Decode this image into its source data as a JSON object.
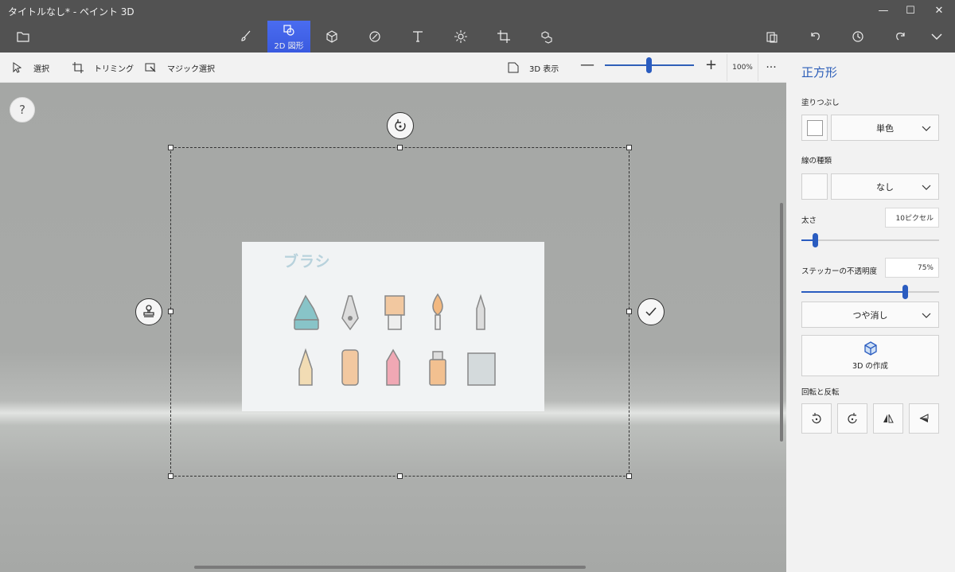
{
  "window": {
    "title": "タイトルなし* - ペイント 3D",
    "minimize": "—",
    "maximize": "☐",
    "close": "✕"
  },
  "toolbar": {
    "active_tool_label": "2D 図形",
    "tools": [
      "folder-icon",
      "brush-icon",
      "cube-icon",
      "sticker-icon",
      "text-icon",
      "effects-icon",
      "crop-icon",
      "mixed-reality-icon"
    ],
    "right_tools": [
      "paste-icon",
      "undo-icon",
      "history-icon",
      "redo-icon",
      "expand-icon"
    ]
  },
  "subbar": {
    "select": "選択",
    "crop": "トリミング",
    "magic_select": "マジック選択",
    "view3d": "3D 表示",
    "zoom_minus": "—",
    "zoom_plus": "+",
    "zoom_percent": "100%",
    "more": "···"
  },
  "canvas": {
    "help": "?",
    "sticker_title": "ブラシ"
  },
  "panel": {
    "title": "正方形",
    "fill_label": "塗りつぶし",
    "fill_value": "単色",
    "line_type_label": "線の種類",
    "line_type_value": "なし",
    "thickness_label": "太さ",
    "thickness_value": "10ピクセル",
    "thickness_level": 0.1,
    "opacity_label": "ステッカーの不透明度",
    "opacity_value": "75%",
    "opacity_level": 0.75,
    "finish_value": "つや消し",
    "make3d_label": "3D の作成",
    "rotate_label": "回転と反転"
  },
  "colors": {
    "accent": "#2a5cc0",
    "active_tool": "#4a6cf0",
    "titlebar": "#525252"
  }
}
